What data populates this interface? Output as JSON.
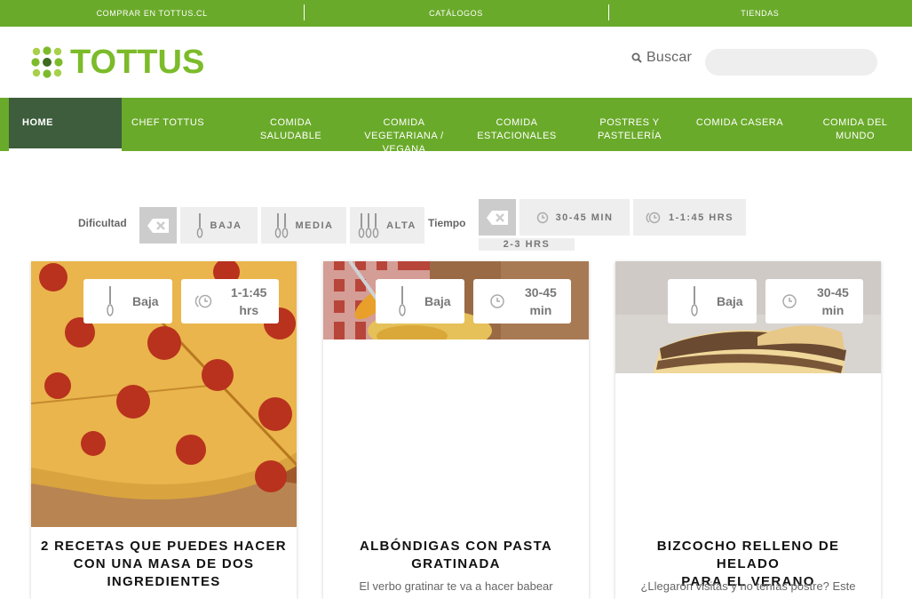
{
  "topbar": {
    "links": [
      "COMPRAR EN TOTTUS.CL",
      "CATÁLOGOS",
      "TIENDAS"
    ]
  },
  "header": {
    "logo_text": "TOTTUS",
    "search_label": "Buscar",
    "search_placeholder": "",
    "brand_color": "#7cbb2a"
  },
  "nav": {
    "items": [
      {
        "label": "HOME",
        "active": true
      },
      {
        "label": "CHEF TOTTUS"
      },
      {
        "label": "COMIDA SALUDABLE"
      },
      {
        "label": "COMIDA VEGETARIANA / VEGANA"
      },
      {
        "label": "COMIDA ESTACIONALES"
      },
      {
        "label": "POSTRES Y PASTELERÍA"
      },
      {
        "label": "COMIDA CASERA"
      },
      {
        "label": "COMIDA DEL MUNDO"
      }
    ],
    "color": "#6aaa2a",
    "active_color": "#3d5d3c"
  },
  "filters": {
    "difficulty_label": "Dificultad",
    "difficulty_options": [
      "BAJA",
      "MEDIA",
      "ALTA"
    ],
    "time_label": "Tiempo",
    "time_options": [
      "30-45 MIN",
      "1-1:45 HRS",
      "2-3 HRS"
    ]
  },
  "recipes": [
    {
      "difficulty": "Baja",
      "time_line1": "1-1:45",
      "time_line2": "hrs",
      "title_lines": [
        "2 RECETAS QUE PUEDES HACER",
        "CON UNA MASA DE DOS",
        "INGREDIENTES"
      ],
      "description": ""
    },
    {
      "difficulty": "Baja",
      "time_line1": "30-45",
      "time_line2": "min",
      "title_lines": [
        "ALBÓNDIGAS CON PASTA",
        "GRATINADA"
      ],
      "description": "El verbo gratinar te va a hacer babear"
    },
    {
      "difficulty": "Baja",
      "time_line1": "30-45",
      "time_line2": "min",
      "title_lines": [
        "BIZCOCHO RELLENO DE HELADO",
        "PARA EL VERANO"
      ],
      "description": "¿Llegaron visitas y no tenías postre? Este"
    }
  ]
}
